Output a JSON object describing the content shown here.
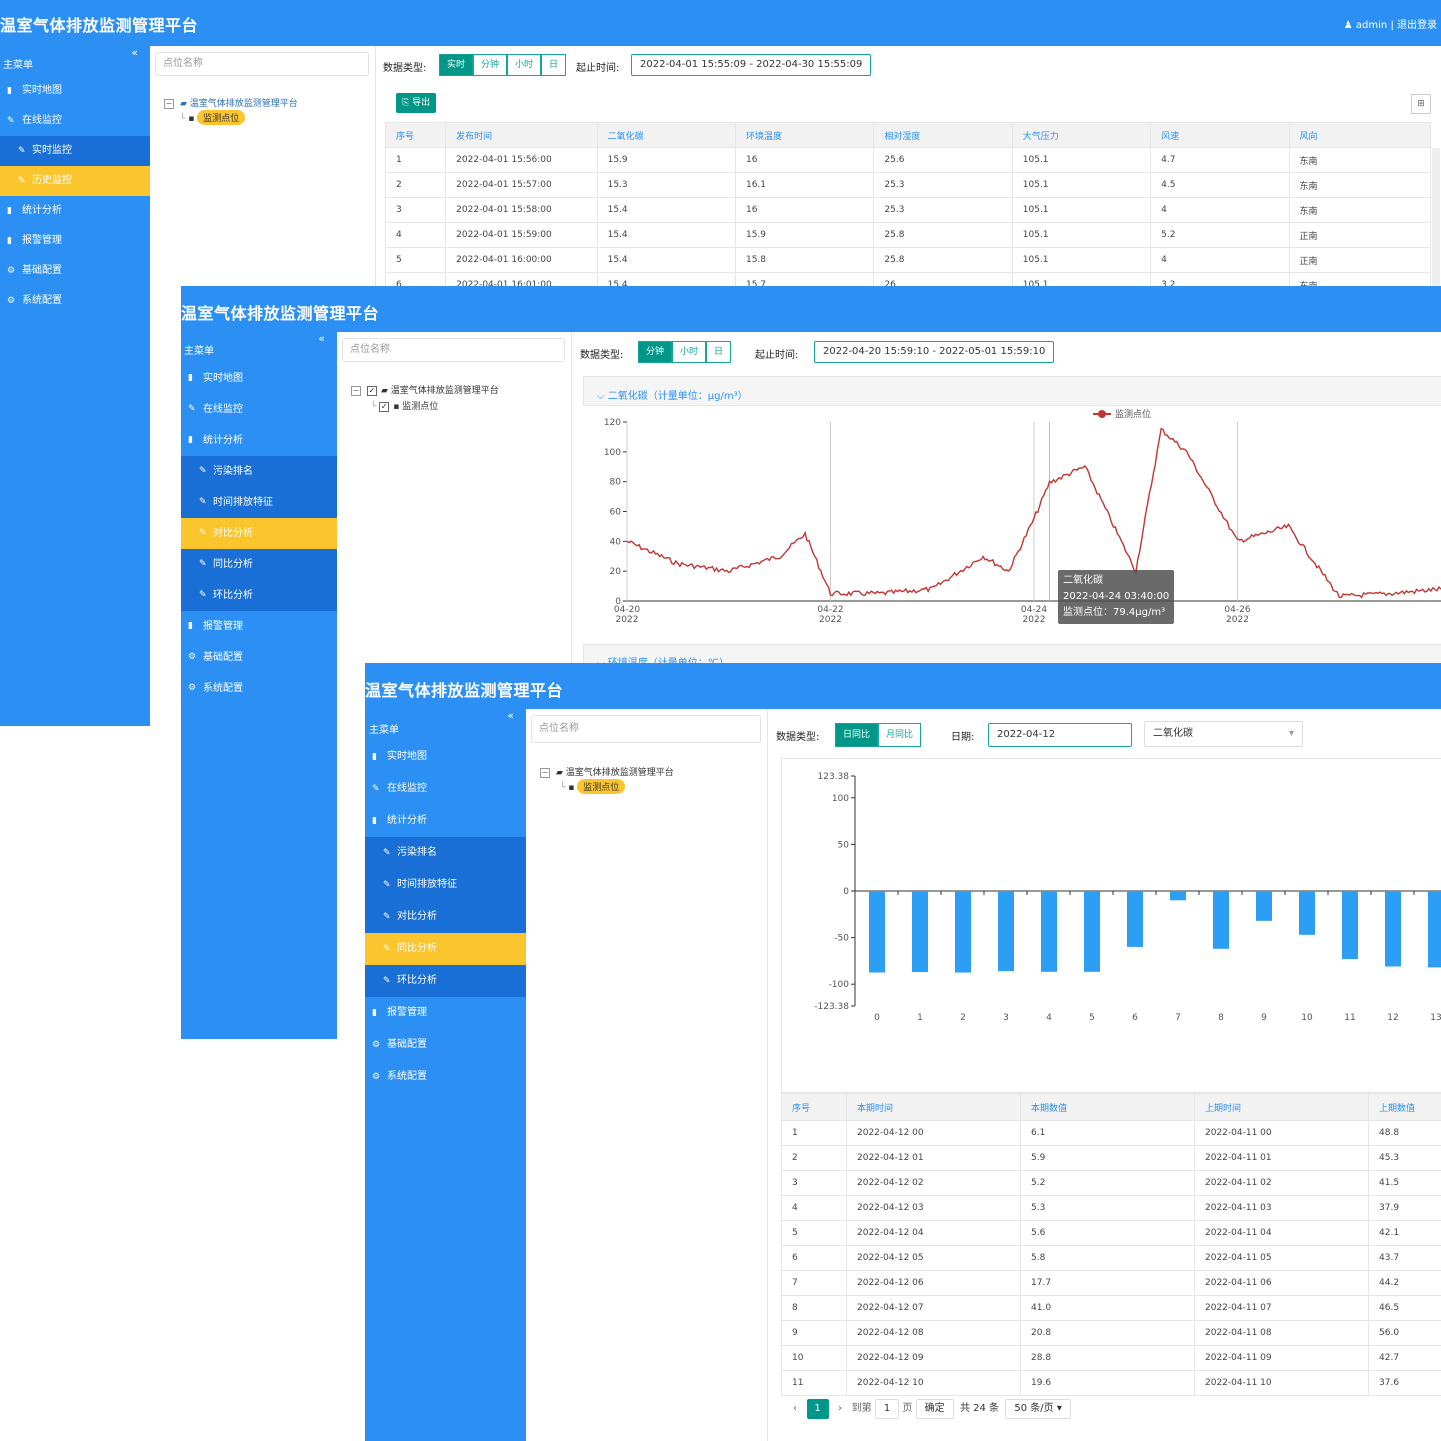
{
  "app_title": "温室气体排放监测管理平台",
  "header": {
    "user": "♟ admin",
    "sep": " | ",
    "logout": "退出登录"
  },
  "menu_title": "主菜单",
  "collapse_glyph": "«",
  "search_placeholder": "点位名称",
  "tree_root": "温室气体排放监测管理平台",
  "tree_child": "监测点位",
  "win1": {
    "menu": [
      "实时地图",
      "在线监控",
      "实时监控",
      "历史监控",
      "统计分析",
      "报警管理",
      "基础配置",
      "系统配置"
    ],
    "data_type_label": "数据类型:",
    "types": [
      "实时",
      "分钟",
      "小时",
      "日"
    ],
    "range_label": "起止时间:",
    "range": "2022-04-01 15:55:09 - 2022-04-30 15:55:09",
    "export": "导出",
    "columns": [
      "序号",
      "发布时间",
      "二氧化碳",
      "环境温度",
      "相对湿度",
      "大气压力",
      "风速",
      "风向"
    ],
    "rows": [
      [
        "1",
        "2022-04-01 15:56:00",
        "15.9",
        "16",
        "25.6",
        "105.1",
        "4.7",
        "东南"
      ],
      [
        "2",
        "2022-04-01 15:57:00",
        "15.3",
        "16.1",
        "25.3",
        "105.1",
        "4.5",
        "东南"
      ],
      [
        "3",
        "2022-04-01 15:58:00",
        "15.4",
        "16",
        "25.3",
        "105.1",
        "4",
        "东南"
      ],
      [
        "4",
        "2022-04-01 15:59:00",
        "15.4",
        "15.9",
        "25.8",
        "105.1",
        "5.2",
        "正南"
      ],
      [
        "5",
        "2022-04-01 16:00:00",
        "15.4",
        "15.8",
        "25.8",
        "105.1",
        "4",
        "正南"
      ],
      [
        "6",
        "2022-04-01 16:01:00",
        "15.4",
        "15.7",
        "26",
        "105.1",
        "3.2",
        "东南"
      ]
    ]
  },
  "win2": {
    "menu": [
      "实时地图",
      "在线监控",
      "统计分析",
      "污染排名",
      "时间排放特征",
      "对比分析",
      "同比分析",
      "环比分析",
      "报警管理",
      "基础配置",
      "系统配置"
    ],
    "data_type_label": "数据类型:",
    "types": [
      "分钟",
      "小时",
      "日"
    ],
    "range_label": "起止时间:",
    "range": "2022-04-20 15:59:10 - 2022-05-01 15:59:10",
    "panel_title": "二氧化碳（计量单位：μg/m³）",
    "panel2_title": "环境温度（计量单位：℃）",
    "legend": "监测点位",
    "tooltip": {
      "name": "二氧化碳",
      "time": "2022-04-24 03:40:00",
      "value": "监测点位：79.4μg/m³"
    },
    "yticks": [
      "0",
      "20",
      "40",
      "60",
      "80",
      "100",
      "120"
    ],
    "xticks": [
      [
        "04-20",
        "2022"
      ],
      [
        "04-22",
        "2022"
      ],
      [
        "04-24",
        "2022"
      ],
      [
        "04-26",
        "2022"
      ]
    ]
  },
  "win3": {
    "menu": [
      "实时地图",
      "在线监控",
      "统计分析",
      "污染排名",
      "时间排放特征",
      "对比分析",
      "同比分析",
      "环比分析",
      "报警管理",
      "基础配置",
      "系统配置"
    ],
    "data_type_label": "数据类型:",
    "types": [
      "日同比",
      "月同比"
    ],
    "date_label": "日期:",
    "date": "2022-04-12",
    "pollutant": "二氧化碳",
    "yticks": [
      "123.38",
      "100",
      "50",
      "0",
      "-50",
      "-100",
      "-123.38"
    ],
    "columns": [
      "序号",
      "本期时间",
      "本期数值",
      "上期时间",
      "上期数值"
    ],
    "rows": [
      [
        "1",
        "2022-04-12 00",
        "6.1",
        "2022-04-11 00",
        "48.8"
      ],
      [
        "2",
        "2022-04-12 01",
        "5.9",
        "2022-04-11 01",
        "45.3"
      ],
      [
        "3",
        "2022-04-12 02",
        "5.2",
        "2022-04-11 02",
        "41.5"
      ],
      [
        "4",
        "2022-04-12 03",
        "5.3",
        "2022-04-11 03",
        "37.9"
      ],
      [
        "5",
        "2022-04-12 04",
        "5.6",
        "2022-04-11 04",
        "42.1"
      ],
      [
        "6",
        "2022-04-12 05",
        "5.8",
        "2022-04-11 05",
        "43.7"
      ],
      [
        "7",
        "2022-04-12 06",
        "17.7",
        "2022-04-11 06",
        "44.2"
      ],
      [
        "8",
        "2022-04-12 07",
        "41.0",
        "2022-04-11 07",
        "46.5"
      ],
      [
        "9",
        "2022-04-12 08",
        "20.8",
        "2022-04-11 08",
        "56.0"
      ],
      [
        "10",
        "2022-04-12 09",
        "28.8",
        "2022-04-11 09",
        "42.7"
      ],
      [
        "11",
        "2022-04-12 10",
        "19.6",
        "2022-04-11 10",
        "37.6"
      ]
    ],
    "pager": {
      "prev": "‹",
      "page": "1",
      "next": "›",
      "goto": "到第",
      "goto_val": "1",
      "page_unit": "页",
      "confirm": "确定",
      "total": "共 24 条",
      "per_page": "50 条/页"
    }
  },
  "colors": {
    "header": "#2c8ff4",
    "active": "#fbc52d",
    "sub": "#1a6fd6",
    "teal": "#009688",
    "line": "#c23531",
    "bar": "#2c9ef4"
  },
  "chart_data": [
    {
      "type": "line",
      "title": "二氧化碳（计量单位：μg/m³）",
      "series": [
        {
          "name": "监测点位"
        }
      ],
      "x": [
        "2022-04-20",
        "2022-04-20 12:00",
        "2022-04-21",
        "2022-04-21 12:00",
        "2022-04-21 18:00",
        "2022-04-22",
        "2022-04-22 12:00",
        "2022-04-23",
        "2022-04-23 12:00",
        "2022-04-23 18:00",
        "2022-04-24",
        "2022-04-24 03:40",
        "2022-04-24 12:00",
        "2022-04-25",
        "2022-04-25 06:00",
        "2022-04-25 12:00",
        "2022-04-26",
        "2022-04-26 12:00",
        "2022-04-27",
        "2022-04-27 12:00",
        "2022-04-28"
      ],
      "values": [
        40,
        25,
        20,
        30,
        45,
        5,
        5,
        8,
        30,
        20,
        55,
        79.4,
        90,
        20,
        115,
        100,
        40,
        50,
        3,
        5,
        8
      ],
      "ylim": [
        0,
        120
      ],
      "xlim": [
        "2022-04-20",
        "2022-04-28"
      ],
      "yticks": [
        0,
        20,
        40,
        60,
        80,
        100,
        120
      ],
      "legend": "top",
      "grid": true
    },
    {
      "type": "bar",
      "categories": [
        "0",
        "1",
        "2",
        "3",
        "4",
        "5",
        "6",
        "7",
        "8",
        "9",
        "10",
        "11",
        "12",
        "13"
      ],
      "values": [
        -87.5,
        -87.0,
        -87.5,
        -86.0,
        -86.7,
        -86.7,
        -60.0,
        -10.0,
        -62.0,
        -32.0,
        -47.0,
        -73.0,
        -81.0,
        -82.0
      ],
      "ylim": [
        -123.38,
        123.38
      ],
      "yticks": [
        -123.38,
        -100,
        -50,
        0,
        50,
        100,
        123.38
      ],
      "grid": false
    }
  ]
}
